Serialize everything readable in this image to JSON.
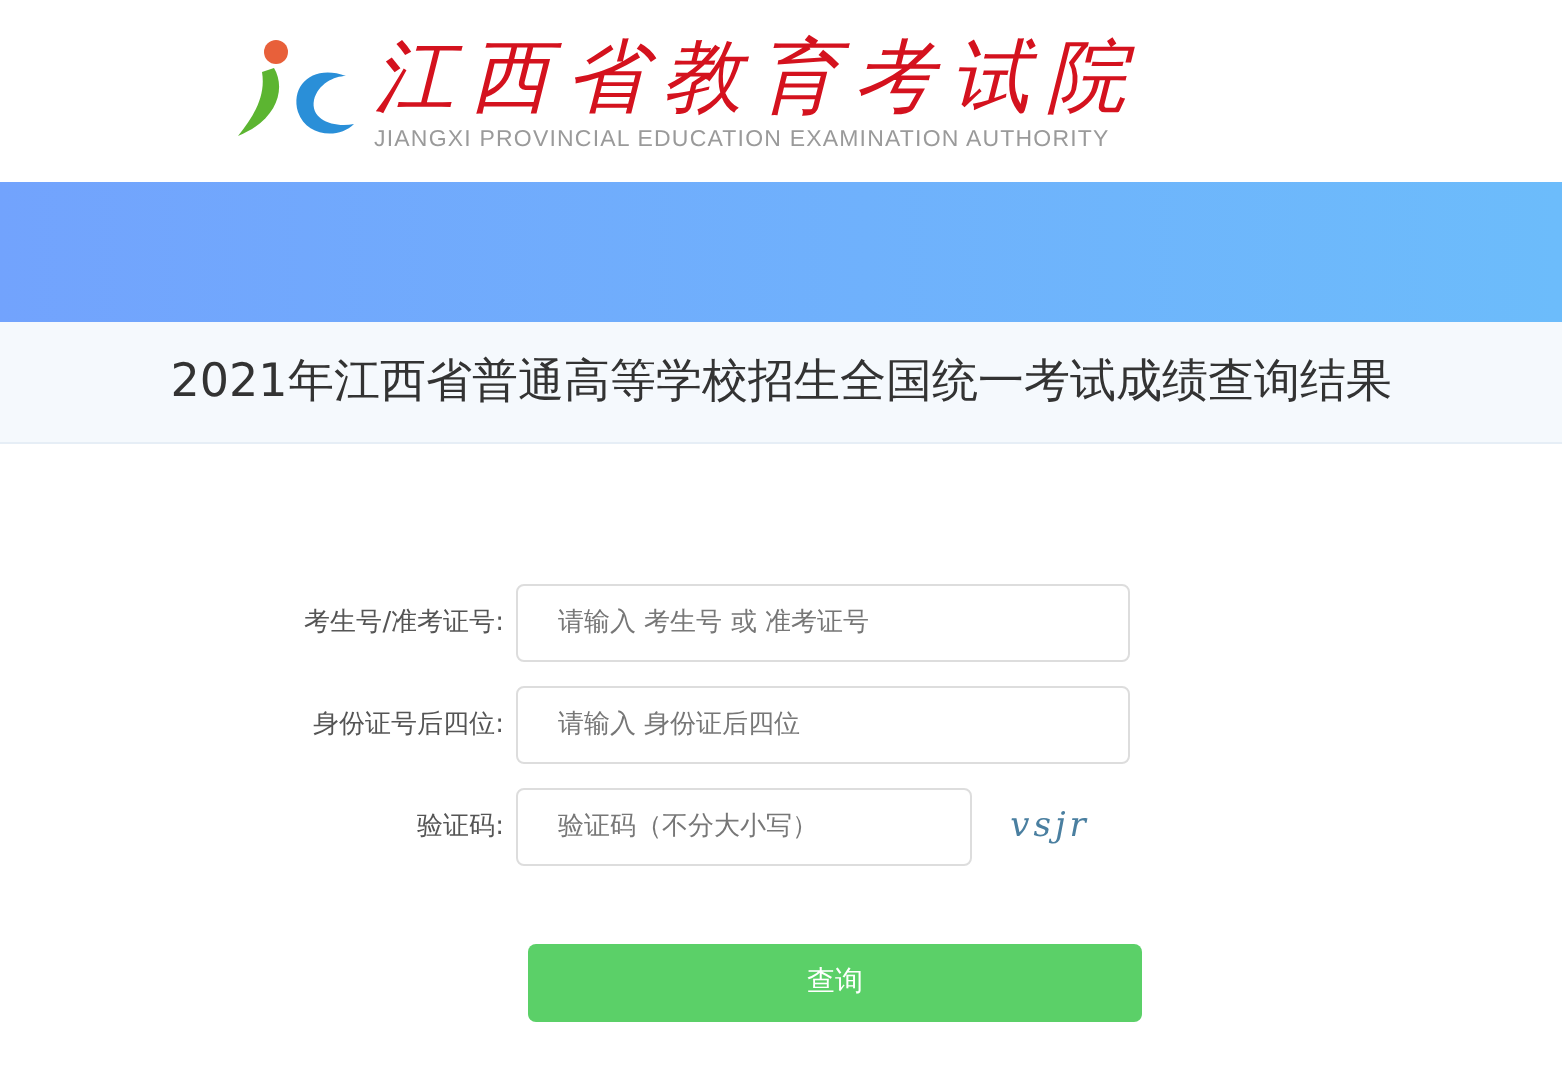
{
  "header": {
    "logo_title": "江西省教育考试院",
    "logo_subtitle": "JIANGXI PROVINCIAL EDUCATION EXAMINATION AUTHORITY"
  },
  "page_title": "2021年江西省普通高等学校招生全国统一考试成绩查询结果",
  "form": {
    "fields": [
      {
        "kind": "text",
        "label": "考生号/准考证号:",
        "placeholder": "请输入 考生号 或 准考证号"
      },
      {
        "kind": "text",
        "label": "身份证号后四位:",
        "placeholder": "请输入 身份证后四位"
      },
      {
        "kind": "captcha",
        "label": "验证码:",
        "placeholder": "验证码（不分大小写）",
        "captcha_text": "vsjr"
      }
    ],
    "submit": "查询"
  }
}
